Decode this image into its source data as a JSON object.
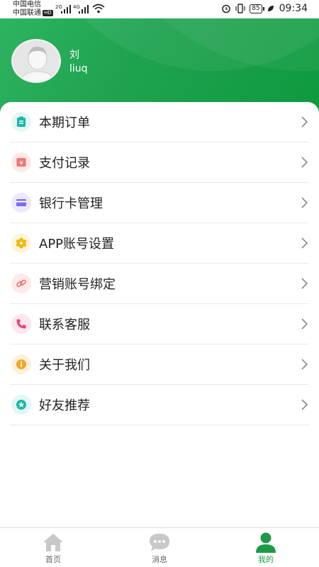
{
  "status_bar": {
    "carrier_1": "中国电信",
    "carrier_2": "中国联通",
    "hd_badge": "HD",
    "net_1": "2G",
    "net_2": "4G",
    "battery": "85",
    "time": "09:34"
  },
  "profile": {
    "name": "刘",
    "account": "liuq"
  },
  "menu": [
    {
      "label": "本期订单",
      "icon": "clipboard-icon",
      "color": "#1bb7a7",
      "bg": "#e3f6f3"
    },
    {
      "label": "支付记录",
      "icon": "yen-icon",
      "color": "#f07373",
      "bg": "#fde9e9"
    },
    {
      "label": "银行卡管理",
      "icon": "card-icon",
      "color": "#7a6cf0",
      "bg": "#ece9fd"
    },
    {
      "label": "APP账号设置",
      "icon": "gear-icon",
      "color": "#f2b705",
      "bg": "#fdf5dc"
    },
    {
      "label": "营销账号绑定",
      "icon": "link-icon",
      "color": "#f07373",
      "bg": "#fde9e9"
    },
    {
      "label": "联系客服",
      "icon": "phone-icon",
      "color": "#e8457a",
      "bg": "#fde6ee"
    },
    {
      "label": "关于我们",
      "icon": "info-icon",
      "color": "#f5a623",
      "bg": "#fdf1de"
    },
    {
      "label": "好友推荐",
      "icon": "star-icon",
      "color": "#1bb7a7",
      "bg": "#e3f6f3"
    }
  ],
  "bottom_nav": [
    {
      "label": "首页",
      "icon": "home-icon",
      "active": false
    },
    {
      "label": "消息",
      "icon": "chat-icon",
      "active": false
    },
    {
      "label": "我的",
      "icon": "user-icon",
      "active": true
    }
  ],
  "colors": {
    "brand_green": "#1e9a46",
    "inactive_gray": "#c8c8c8"
  }
}
